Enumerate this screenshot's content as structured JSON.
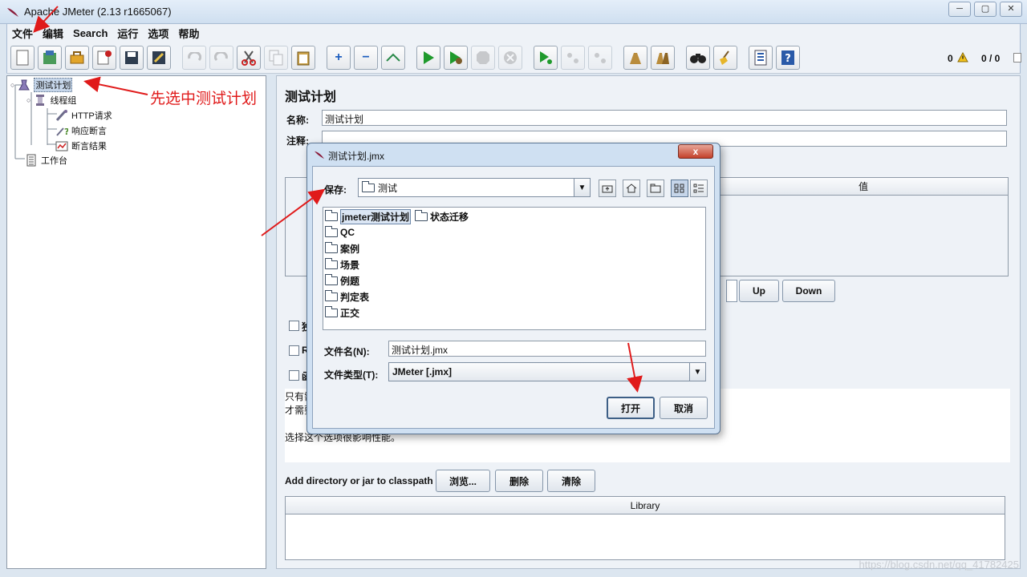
{
  "window": {
    "title": "Apache JMeter (2.13 r1665067)",
    "buttons": [
      "─",
      "▢",
      "✕"
    ]
  },
  "menu": [
    "文件",
    "编辑",
    "Search",
    "运行",
    "选项",
    "帮助"
  ],
  "toolbar": {
    "warning_count": "0",
    "error_ratio": "0 / 0"
  },
  "tree": {
    "root": "测试计划",
    "thread_group": "线程组",
    "http_request": "HTTP请求",
    "response_assertion": "响应断言",
    "assertion_results": "断言结果",
    "workbench": "工作台"
  },
  "test_plan": {
    "heading": "测试计划",
    "name_label": "名称:",
    "name_value": "测试计划",
    "comment_label": "注释:",
    "table_value_header": "值",
    "up_button": "Up",
    "down_button": "Down",
    "desc_line1": "只有需",
    "desc_line2": "才需要",
    "desc_line3": "选择这个选项很影响性能。",
    "classpath_label": "Add directory or jar to classpath",
    "browse_button": "浏览...",
    "delete_button": "删除",
    "clear_button": "清除",
    "library_header": "Library",
    "checkboxes": [
      "独",
      "R",
      "函"
    ]
  },
  "dialog": {
    "title": "测试计划.jmx",
    "save_in_label": "保存:",
    "save_in_value": "测试",
    "folders": [
      "jmeter测试计划",
      "状态迁移",
      "QC",
      "案例",
      "场景",
      "例题",
      "判定表",
      "正交"
    ],
    "filename_label": "文件名(N):",
    "filename_value": "测试计划.jmx",
    "filetype_label": "文件类型(T):",
    "filetype_value": "JMeter [.jmx]",
    "open_button": "打开",
    "cancel_button": "取消"
  },
  "annotation": {
    "text": "先选中测试计划",
    "color": "#e01a1a"
  },
  "watermark": "https://blog.csdn.net/qq_41782425"
}
